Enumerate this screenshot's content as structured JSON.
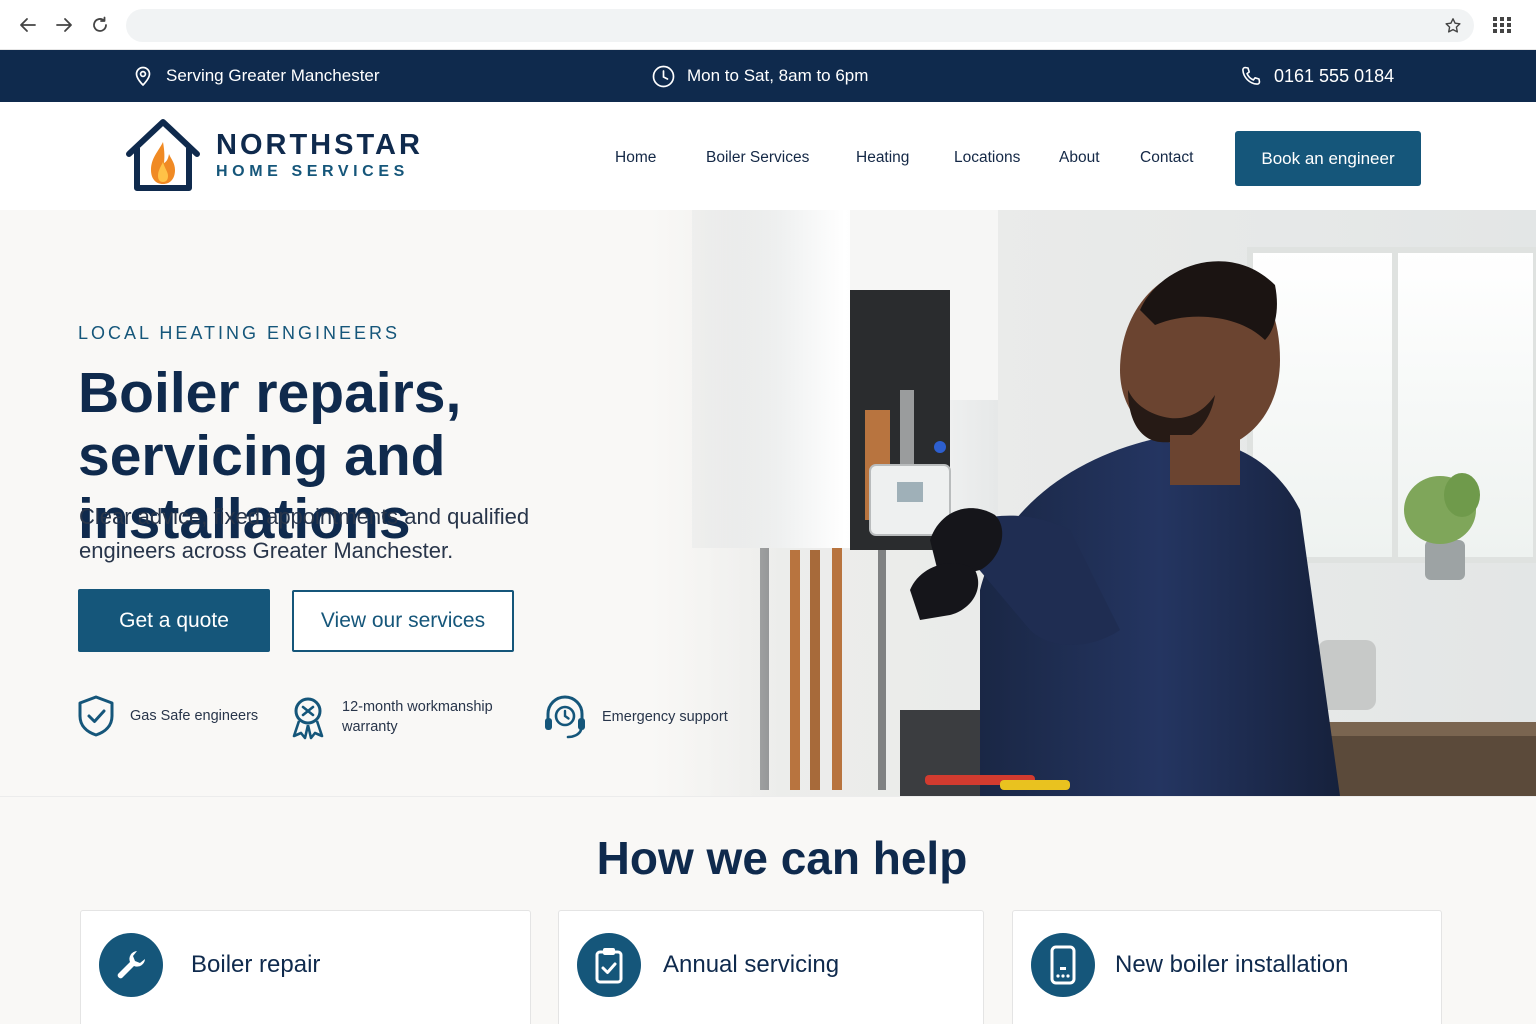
{
  "browser": {
    "address": "",
    "icons": [
      "back-arrow-icon",
      "forward-arrow-icon",
      "reload-icon",
      "star-icon",
      "apps-grid-icon"
    ]
  },
  "topbar": {
    "location": "Serving Greater Manchester",
    "hours": "Mon to Sat, 8am to 6pm",
    "phone": "0161 555 0184"
  },
  "header": {
    "brand": "NORTHSTAR",
    "brand_sub": "HOME SERVICES",
    "nav": [
      "Home",
      "Boiler Services",
      "Heating",
      "Locations",
      "About",
      "Contact"
    ],
    "cta": "Book an engineer"
  },
  "hero": {
    "kicker": "LOCAL HEATING ENGINEERS",
    "headline": "Boiler repairs, servicing and installations",
    "lead": "Clear advice, fixed appointments and qualified engineers across Greater Manchester.",
    "primary_cta": "Get a quote",
    "secondary_cta": "View our services",
    "badges": [
      {
        "icon": "shield-check-icon",
        "text": "Gas Safe engineers"
      },
      {
        "icon": "award-ribbon-icon",
        "text": "12-month workmanship warranty"
      },
      {
        "icon": "headset-clock-icon",
        "text": "Emergency support"
      }
    ]
  },
  "services": {
    "heading": "How we can help",
    "cards": [
      {
        "icon": "wrench-icon",
        "title": "Boiler repair"
      },
      {
        "icon": "clipboard-check-icon",
        "title": "Annual servicing"
      },
      {
        "icon": "boiler-unit-icon",
        "title": "New boiler installation"
      }
    ]
  },
  "colors": {
    "navy": "#0f2a4d",
    "teal_blue": "#15567a",
    "flame_orange": "#f08a24"
  }
}
